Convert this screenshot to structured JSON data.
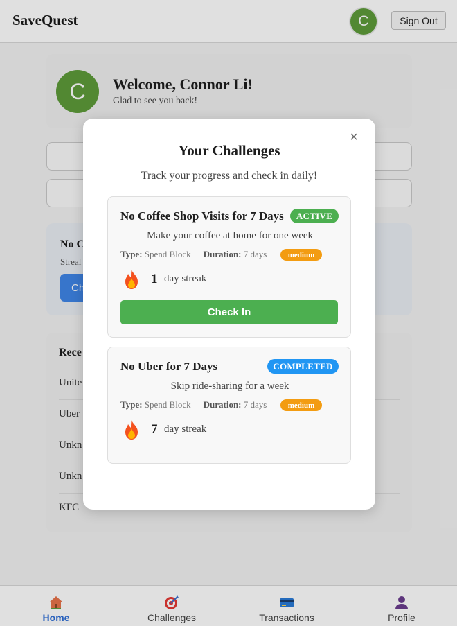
{
  "header": {
    "brand": "SaveQuest",
    "avatar_initial": "C",
    "sign_out_label": "Sign Out"
  },
  "welcome": {
    "avatar_initial": "C",
    "title": "Welcome, Connor Li!",
    "subtitle": "Glad to see you back!"
  },
  "current_challenge": {
    "title_partial": "No C",
    "streak_partial": "Streal",
    "button_partial": "Ch"
  },
  "recent": {
    "title_partial": "Rece",
    "rows": [
      "Unite",
      "Uber",
      "Unkn",
      "Unkn",
      "KFC"
    ]
  },
  "modal": {
    "title": "Your Challenges",
    "subtitle": "Track your progress and check in daily!",
    "close_glyph": "×",
    "challenges": [
      {
        "name": "No Coffee Shop Visits for 7 Days",
        "status": "ACTIVE",
        "status_color": "#4caf50",
        "description": "Make your coffee at home for one week",
        "type_label": "Type:",
        "type_value": "Spend Block",
        "duration_label": "Duration:",
        "duration_value": "7 days",
        "difficulty": "medium",
        "streak": "1",
        "streak_label": "day streak",
        "check_in_label": "Check In"
      },
      {
        "name": "No Uber for 7 Days",
        "status": "COMPLETED",
        "status_color": "#2196f3",
        "description": "Skip ride-sharing for a week",
        "type_label": "Type:",
        "type_value": "Spend Block",
        "duration_label": "Duration:",
        "duration_value": "7 days",
        "difficulty": "medium",
        "streak": "7",
        "streak_label": "day streak"
      }
    ]
  },
  "nav": {
    "active": "Home",
    "items": [
      {
        "label": "Home",
        "icon": "home-icon"
      },
      {
        "label": "Challenges",
        "icon": "target-icon"
      },
      {
        "label": "Transactions",
        "icon": "credit-card-icon"
      },
      {
        "label": "Profile",
        "icon": "user-icon"
      }
    ]
  },
  "colors": {
    "accent_green": "#4caf50",
    "accent_blue": "#2196f3",
    "difficulty_orange": "#f39c12",
    "nav_active": "#2f6fd6",
    "avatar": "#5e9b3a"
  }
}
